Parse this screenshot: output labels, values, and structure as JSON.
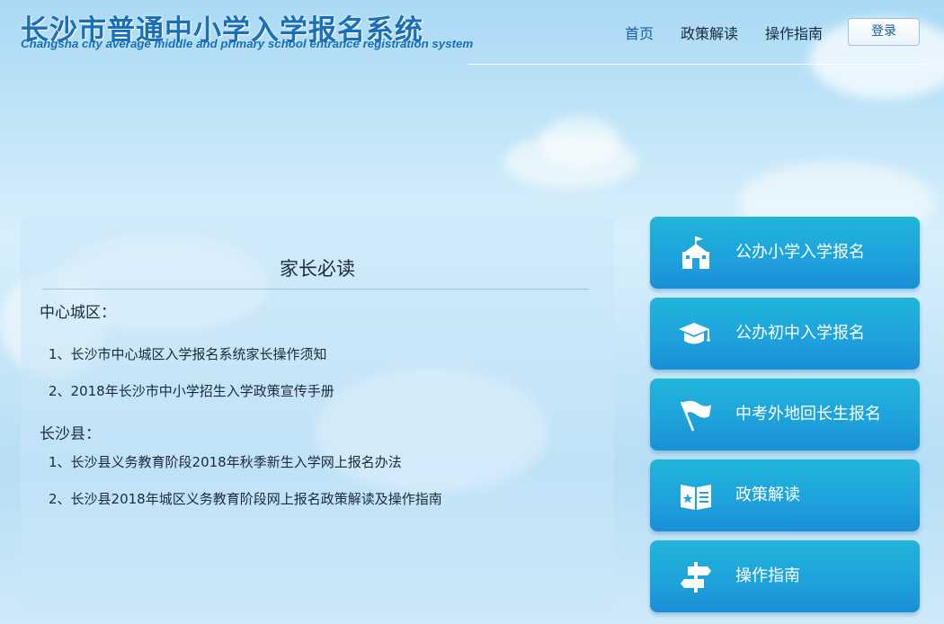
{
  "header": {
    "title_cn": "长沙市普通中小学入学报名系统",
    "title_en": "Changsha city average middle and primary school entrance registration system",
    "nav": [
      "首页",
      "政策解读",
      "操作指南"
    ],
    "login_label": "登录"
  },
  "notice": {
    "title": "家长必读",
    "sections": [
      {
        "heading": "中心城区：",
        "items": [
          "1、长沙市中心城区入学报名系统家长操作须知",
          "2、2018年长沙市中小学招生入学政策宣传手册"
        ]
      },
      {
        "heading": "长沙县：",
        "items": [
          "1、长沙县义务教育阶段2018年秋季新生入学网上报名办法",
          "2、长沙县2018年城区义务教育阶段网上报名政策解读及操作指南"
        ]
      }
    ]
  },
  "entries": [
    {
      "label": "公办小学入学报名",
      "icon": "school-building-icon"
    },
    {
      "label": "公办初中入学报名",
      "icon": "graduation-cap-icon"
    },
    {
      "label": "中考外地回长生报名",
      "icon": "flag-icon"
    },
    {
      "label": "政策解读",
      "icon": "open-book-star-icon"
    },
    {
      "label": "操作指南",
      "icon": "signpost-icon"
    }
  ],
  "colors": {
    "brand": "#1b6fb8",
    "entry_button": "#1ea3dc",
    "text": "#1a2b3c"
  }
}
